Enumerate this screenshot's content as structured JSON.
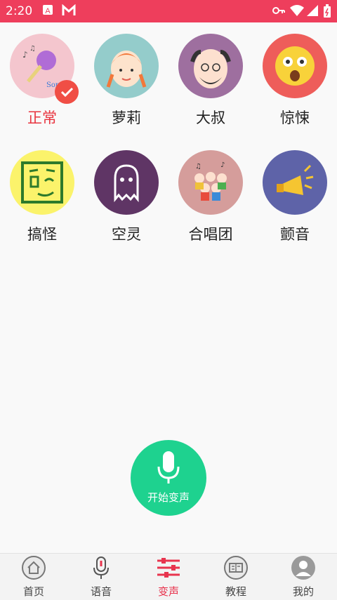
{
  "status_bar": {
    "time": "2:20"
  },
  "voices": [
    {
      "label": "正常",
      "color": "#f4c6ce",
      "selected": true
    },
    {
      "label": "萝莉",
      "color": "#94cccb",
      "selected": false
    },
    {
      "label": "大叔",
      "color": "#9e6f9f",
      "selected": false
    },
    {
      "label": "惊悚",
      "color": "#ee5d5a",
      "selected": false
    },
    {
      "label": "搞怪",
      "color": "#fbf36b",
      "selected": false
    },
    {
      "label": "空灵",
      "color": "#5f3565",
      "selected": false
    },
    {
      "label": "合唱团",
      "color": "#d59d9b",
      "selected": false
    },
    {
      "label": "颤音",
      "color": "#5e63a8",
      "selected": false
    }
  ],
  "start_button": {
    "label": "开始变声"
  },
  "tabs": [
    {
      "label": "首页",
      "icon": "home-icon"
    },
    {
      "label": "语音",
      "icon": "microphone-icon"
    },
    {
      "label": "变声",
      "icon": "sliders-icon",
      "active": true
    },
    {
      "label": "教程",
      "icon": "book-icon"
    },
    {
      "label": "我的",
      "icon": "user-icon"
    }
  ]
}
